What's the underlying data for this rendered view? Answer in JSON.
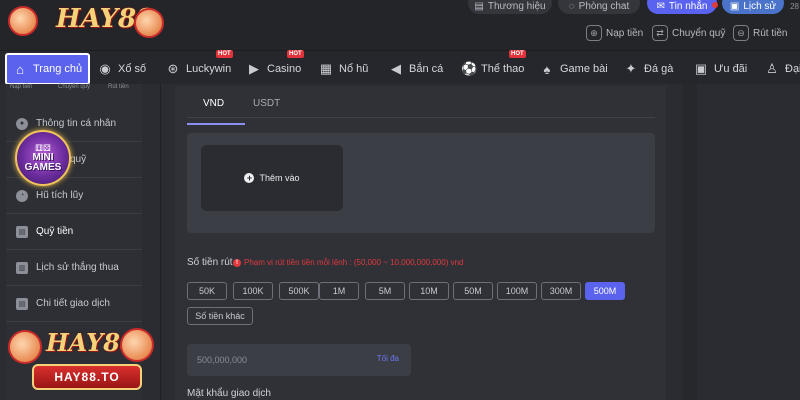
{
  "brand": {
    "logo_text": "HAY88",
    "badge": "HAY88.TO"
  },
  "top_actions": [
    {
      "label": "Thương hiệu",
      "icon": "building-icon"
    },
    {
      "label": "Phòng chat",
      "icon": "chat-icon"
    },
    {
      "label": "Tin nhắn",
      "icon": "message-icon"
    },
    {
      "label": "Lịch sử",
      "icon": "history-icon"
    }
  ],
  "top_number": "28",
  "wallet": [
    {
      "label": "Nạp tiền",
      "icon": "deposit-icon"
    },
    {
      "label": "Chuyển quỹ",
      "icon": "transfer-icon"
    },
    {
      "label": "Rút tiền",
      "icon": "withdraw-icon"
    }
  ],
  "nav": [
    {
      "label": "Trang chủ",
      "icon": "home-icon",
      "active": true
    },
    {
      "label": "Xổ số",
      "icon": "lottery-icon"
    },
    {
      "label": "Luckywin",
      "icon": "ball-icon",
      "hot": true
    },
    {
      "label": "Casino",
      "icon": "casino-icon",
      "hot": true
    },
    {
      "label": "Nổ hũ",
      "icon": "slot-icon"
    },
    {
      "label": "Bắn cá",
      "icon": "fish-icon"
    },
    {
      "label": "Thể thao",
      "icon": "soccer-icon",
      "hot": true
    },
    {
      "label": "Game bài",
      "icon": "cards-icon"
    },
    {
      "label": "Đá gà",
      "icon": "rooster-icon"
    },
    {
      "label": "Ưu đãi",
      "icon": "promo-icon"
    },
    {
      "label": "Đại",
      "icon": "agent-icon"
    }
  ],
  "hot_label": "HOT",
  "sidebar_sublabels": [
    "Nạp tiền",
    "Chuyển quỹ",
    "Rút tiền"
  ],
  "sidebar": [
    {
      "label": "Thông tin cá nhân",
      "icon": "user-icon"
    },
    {
      "label": "quỹ",
      "icon": "wallet-icon"
    },
    {
      "label": "Hũ tích lũy",
      "icon": "jar-icon"
    },
    {
      "label": "Quỹ tiền",
      "icon": "fund-icon",
      "active": true
    },
    {
      "label": "Lịch sử thắng thua",
      "icon": "history-icon"
    },
    {
      "label": "Chi tiết giao dịch",
      "icon": "receipt-icon"
    }
  ],
  "mini_games": {
    "line1": "MINI",
    "line2": "GAMES"
  },
  "tabs": [
    "VND",
    "USDT"
  ],
  "bank": {
    "add_label": "Thêm vào"
  },
  "amount": {
    "label": "Số tiền rút",
    "range_note": "Phạm vi rút tiền tiền mỗi lệnh : (50,000 ~ 10,000,000,000) vnd",
    "chips": [
      "50K",
      "100K",
      "500K",
      "1M",
      "5M",
      "10M",
      "50M",
      "100M",
      "300M",
      "500M"
    ],
    "active_chip": "500M",
    "other_label": "Số tiền khác",
    "input_placeholder": "500,000,000",
    "max_label": "Tối đa"
  },
  "password_label": "Mật khẩu giao dịch",
  "colors": {
    "accent": "#5b63ee",
    "warning": "#e0393e",
    "background": "#2a2c31"
  }
}
